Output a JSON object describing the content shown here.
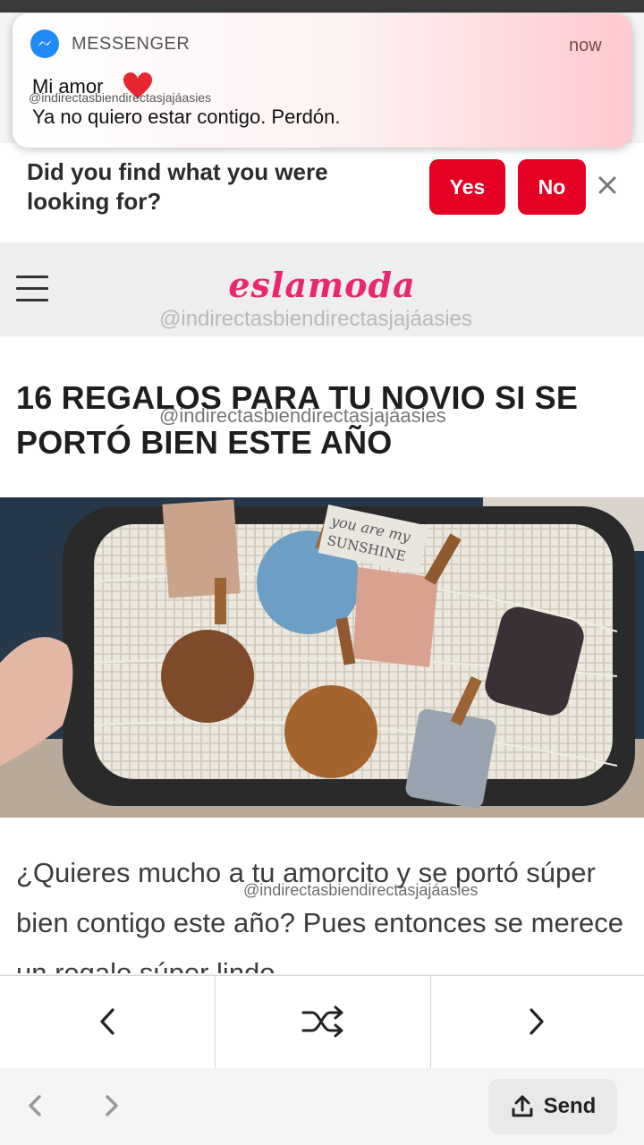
{
  "notification": {
    "app_name": "MESSENGER",
    "time": "now",
    "sender": "Mi amor",
    "message": "Ya no quiero estar contigo. Perdón."
  },
  "feedback": {
    "question": "Did you find what you were looking for?",
    "yes_label": "Yes",
    "no_label": "No"
  },
  "site": {
    "logo": "eslamoda"
  },
  "article": {
    "headline": "16 REGALOS PARA TU NOVIO SI SE PORTÓ BIEN ESTE AÑO",
    "paragraph": "¿Quieres mucho a tu amorcito y se portó súper bien contigo este año? Pues entonces se merece un regalo súper lindo",
    "image_caption": "you are my SUNSHINE"
  },
  "watermark": "@indirectasbiendirectasjajáasies",
  "browser": {
    "send_label": "Send"
  },
  "colors": {
    "accent": "#e60023",
    "logo": "#e8276f",
    "messenger": "#1f8af5"
  }
}
